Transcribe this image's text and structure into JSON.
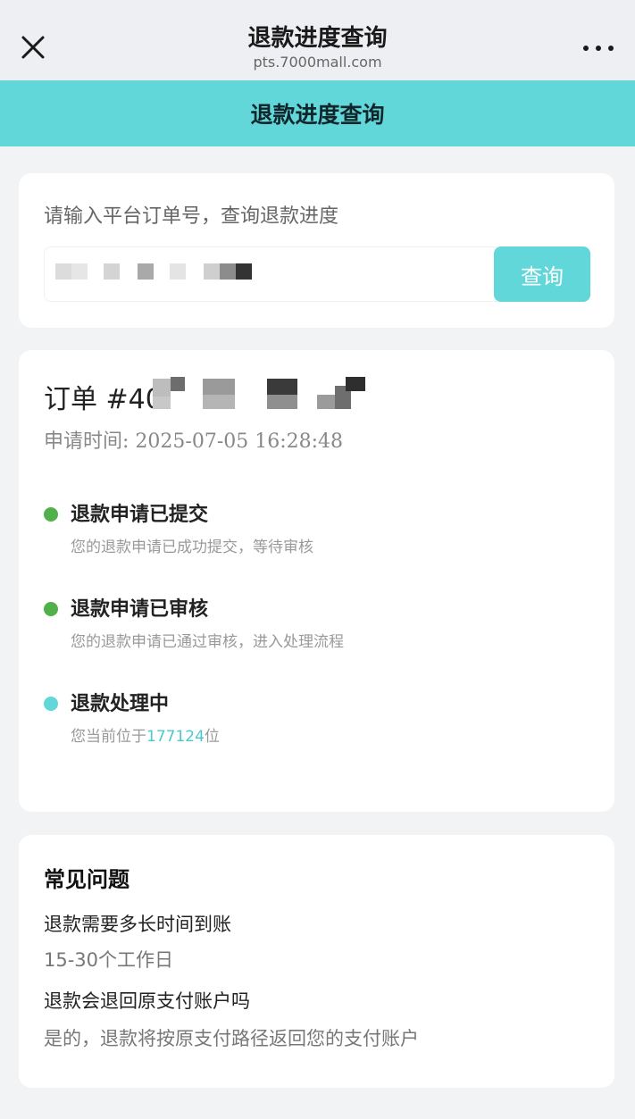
{
  "browser": {
    "title": "退款进度查询",
    "url": "pts.7000mall.com",
    "close_icon": "close-icon",
    "more_icon": "more-icon"
  },
  "header": {
    "title": "退款进度查询"
  },
  "search": {
    "hint": "请输入平台订单号，查询退款进度",
    "button_label": "查询"
  },
  "order": {
    "title_prefix": "订单 #40",
    "apply_time": "申请时间: 2025-07-05 16:28:48",
    "steps": [
      {
        "title": "退款申请已提交",
        "desc": "您的退款申请已成功提交，等待审核",
        "status_color": "#52b04a"
      },
      {
        "title": "退款申请已审核",
        "desc": "您的退款申请已通过审核，进入处理流程",
        "status_color": "#52b04a"
      },
      {
        "title": "退款处理中",
        "desc_prefix": "您当前位于",
        "position": "177124",
        "desc_suffix": "位",
        "status_color": "#61d7d9"
      }
    ]
  },
  "faq": {
    "heading": "常见问题",
    "items": [
      {
        "q": "退款需要多长时间到账",
        "a": "15-30个工作日"
      },
      {
        "q": "退款会退回原支付账户吗",
        "a": "是的，退款将按原支付路径返回您的支付账户"
      }
    ]
  },
  "colors": {
    "accent": "#61d7d9",
    "done": "#52b04a"
  }
}
